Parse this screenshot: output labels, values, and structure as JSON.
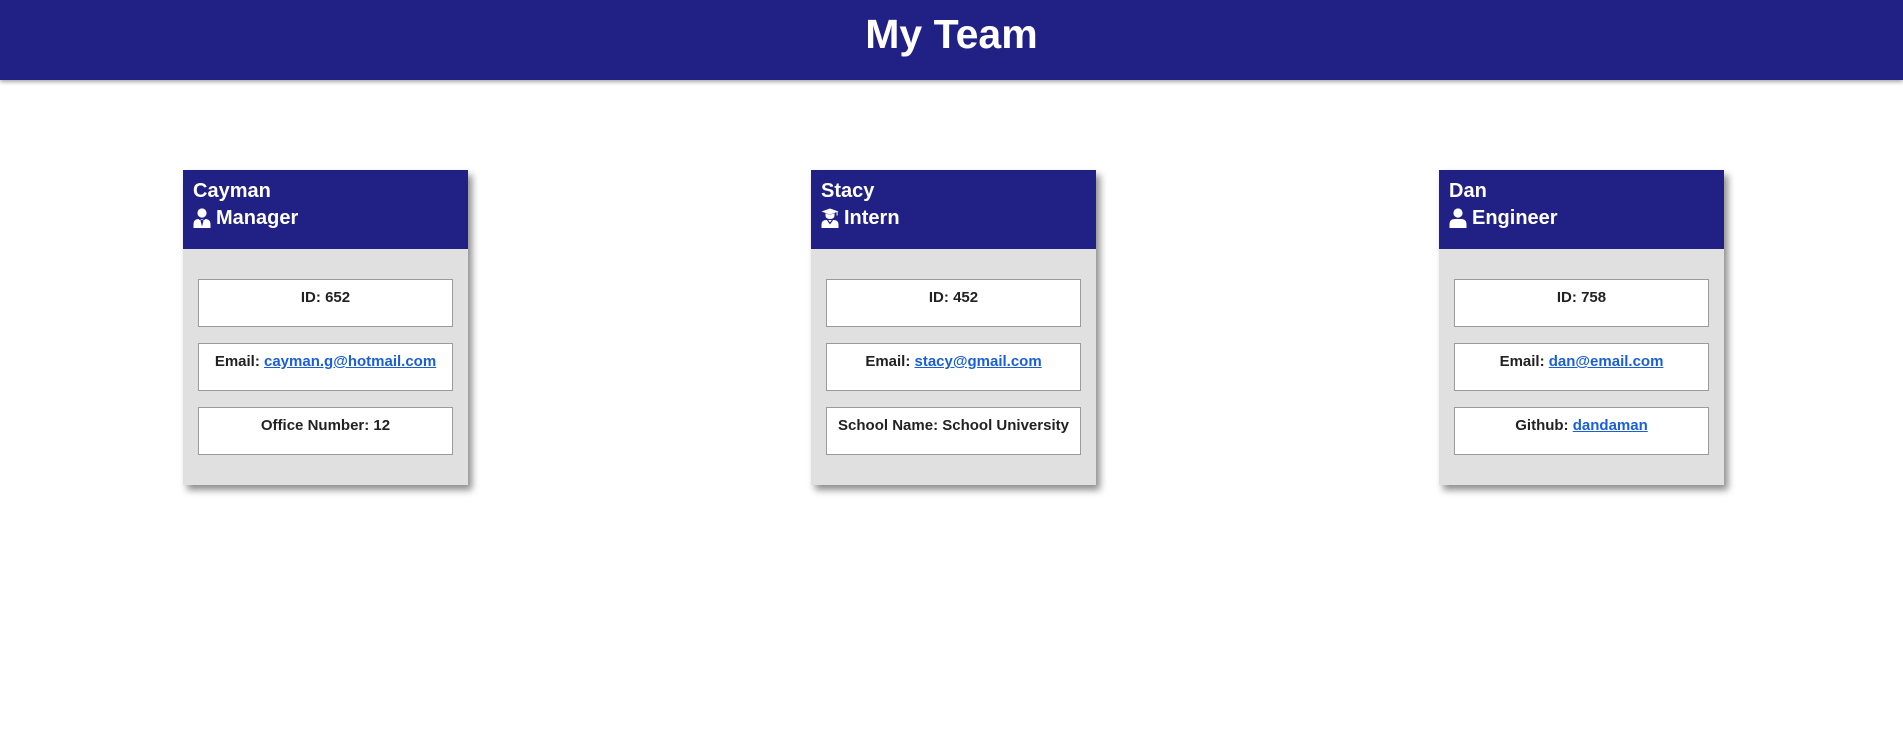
{
  "header": {
    "title": "My Team"
  },
  "colors": {
    "brand": "#212185",
    "card_bg": "#e0e0e0",
    "link": "#1a5fd6"
  },
  "employees": [
    {
      "name": "Cayman",
      "role": "Manager",
      "icon": "manager-icon",
      "id_label": "ID:",
      "id_value": "652",
      "email_label": "Email:",
      "email_value": "cayman.g@hotmail.com",
      "extra_label": "Office Number:",
      "extra_value": "12"
    },
    {
      "name": "Stacy",
      "role": "Intern",
      "icon": "graduate-icon",
      "id_label": "ID:",
      "id_value": "452",
      "email_label": "Email:",
      "email_value": "stacy@gmail.com",
      "extra_label": "School Name:",
      "extra_value": "School University"
    },
    {
      "name": "Dan",
      "role": "Engineer",
      "icon": "user-icon",
      "id_label": "ID:",
      "id_value": "758",
      "email_label": "Email:",
      "email_value": "dan@email.com",
      "extra_label": "Github:",
      "extra_value": "dandaman"
    }
  ]
}
